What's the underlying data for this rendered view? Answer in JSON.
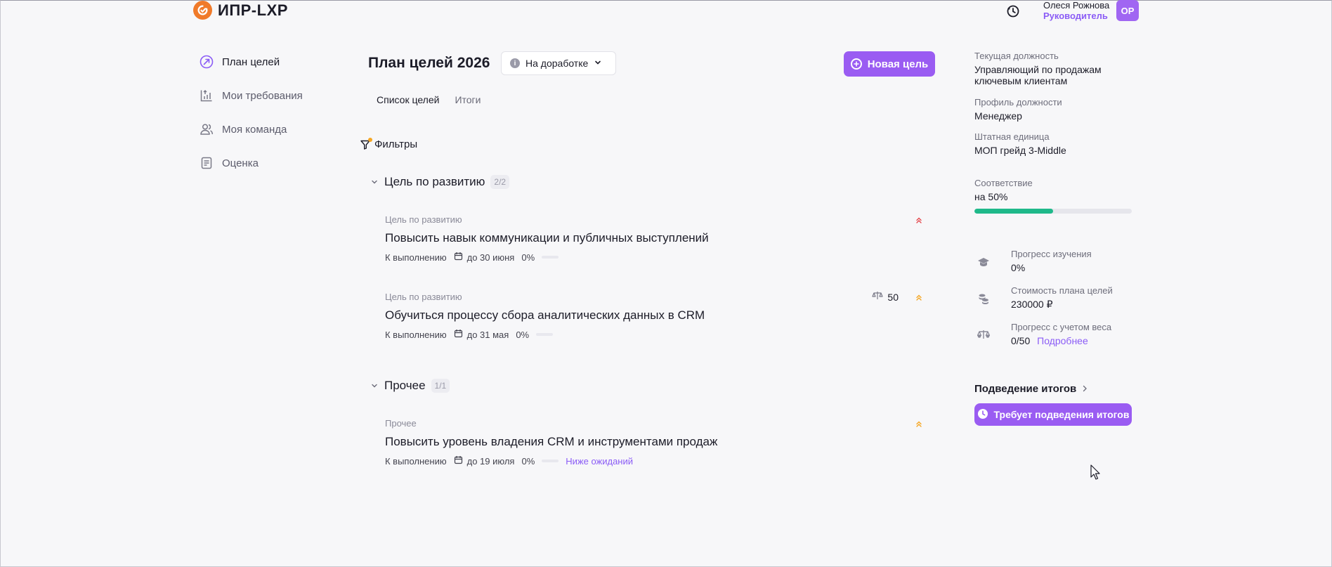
{
  "header": {
    "logo_text": "ИПР-LXP",
    "user_name": "Олеся Рожнова",
    "user_role": "Руководитель",
    "avatar_initials": "ОР"
  },
  "sidebar": {
    "items": [
      {
        "label": "План целей",
        "icon": "target-arrow-icon",
        "active": true
      },
      {
        "label": "Мои требования",
        "icon": "chart-upload-icon",
        "active": false
      },
      {
        "label": "Моя команда",
        "icon": "users-icon",
        "active": false
      },
      {
        "label": "Оценка",
        "icon": "clipboard-icon",
        "active": false
      }
    ]
  },
  "main": {
    "title": "План целей 2026",
    "status": "На доработке",
    "new_goal_label": "Новая цель",
    "tabs": [
      {
        "label": "Список целей",
        "active": true
      },
      {
        "label": "Итоги",
        "active": false
      }
    ],
    "filters_label": "Фильтры",
    "groups": [
      {
        "title": "Цель по развитию",
        "count": "2/2",
        "goals": [
          {
            "type": "Цель по развитию",
            "title": "Повысить навык коммуникации и публичных выступлений",
            "status": "К выполнению",
            "deadline": "до 30 июня",
            "percent": "0%",
            "priority": "high"
          },
          {
            "type": "Цель по развитию",
            "title": "Обучиться процессу сбора аналитических данных в CRM",
            "status": "К выполнению",
            "deadline": "до 31 мая",
            "percent": "0%",
            "weight": "50",
            "priority": "medium"
          }
        ]
      },
      {
        "title": "Прочее",
        "count": "1/1",
        "goals": [
          {
            "type": "Прочее",
            "title": "Повысить уровень владения CRM и инструментами продаж",
            "status": "К выполнению",
            "deadline": "до 19 июля",
            "percent": "0%",
            "rating": "Ниже ожиданий",
            "priority": "medium"
          }
        ]
      }
    ]
  },
  "right_panel": {
    "position_label": "Текущая должность",
    "position_value": "Управляющий по продажам ключевым клиентам",
    "profile_label": "Профиль должности",
    "profile_value": "Менеджер",
    "unit_label": "Штатная единица",
    "unit_value": "МОП грейд 3-Middle",
    "match_label": "Соответствие",
    "match_value": "на 50%",
    "match_progress": 0.5,
    "stats": [
      {
        "label": "Прогресс изучения",
        "value": "0%",
        "icon": "graduation-cap-icon"
      },
      {
        "label": "Стоимость плана целей",
        "value": "230000 ₽",
        "icon": "coins-icon"
      },
      {
        "label": "Прогресс с учетом веса",
        "value": "0/50",
        "link": "Подробнее",
        "icon": "scales-icon"
      }
    ],
    "summary_label": "Подведение итогов",
    "summary_button": "Требует подведения итогов"
  },
  "colors": {
    "accent": "#9a5cf2",
    "progress": "#1fb98a",
    "priority_high": "#e5484d",
    "priority_medium": "#f5a623",
    "logo": "#f07a2a"
  }
}
